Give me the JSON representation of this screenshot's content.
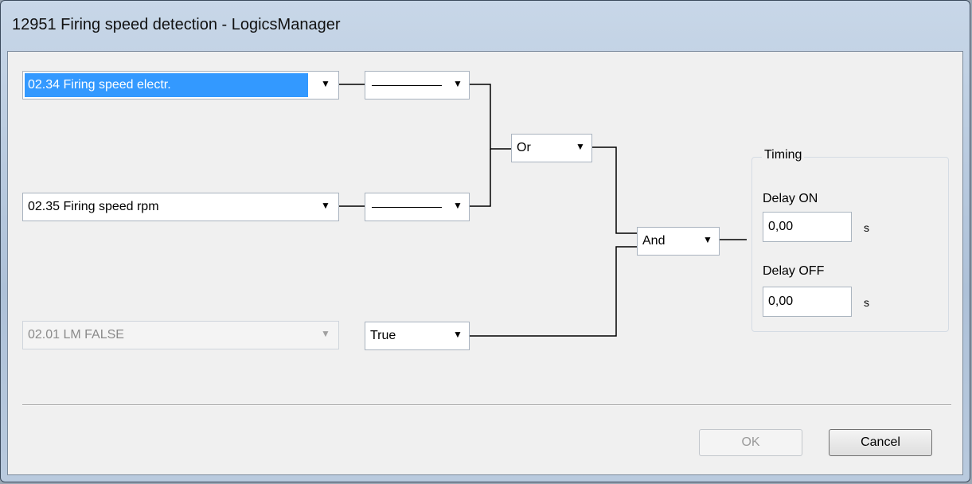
{
  "window": {
    "title": "12951 Firing speed detection - LogicsManager"
  },
  "inputs": [
    {
      "value": "02.34 Firing speed electr.",
      "state": "selected"
    },
    {
      "value": "02.35 Firing speed rpm",
      "state": "normal"
    },
    {
      "value": "02.01 LM FALSE",
      "state": "disabled"
    }
  ],
  "signs": [
    {
      "value": "———",
      "display": "dash"
    },
    {
      "value": "———",
      "display": "dash"
    },
    {
      "value": "True",
      "display": "text"
    }
  ],
  "operators": {
    "first": "Or",
    "second": "And"
  },
  "timing": {
    "title": "Timing",
    "delay_on_label": "Delay ON",
    "delay_on_value": "0,00",
    "delay_on_unit": "s",
    "delay_off_label": "Delay OFF",
    "delay_off_value": "0,00",
    "delay_off_unit": "s"
  },
  "buttons": {
    "ok_label": "OK",
    "ok_enabled": false,
    "cancel_label": "Cancel"
  },
  "icons": {
    "dropdown": "triangle-down-icon"
  },
  "colors": {
    "selection": "#3399ff",
    "dialog_bg": "#f0f0f0",
    "titlebar": "#c8d7e8"
  }
}
